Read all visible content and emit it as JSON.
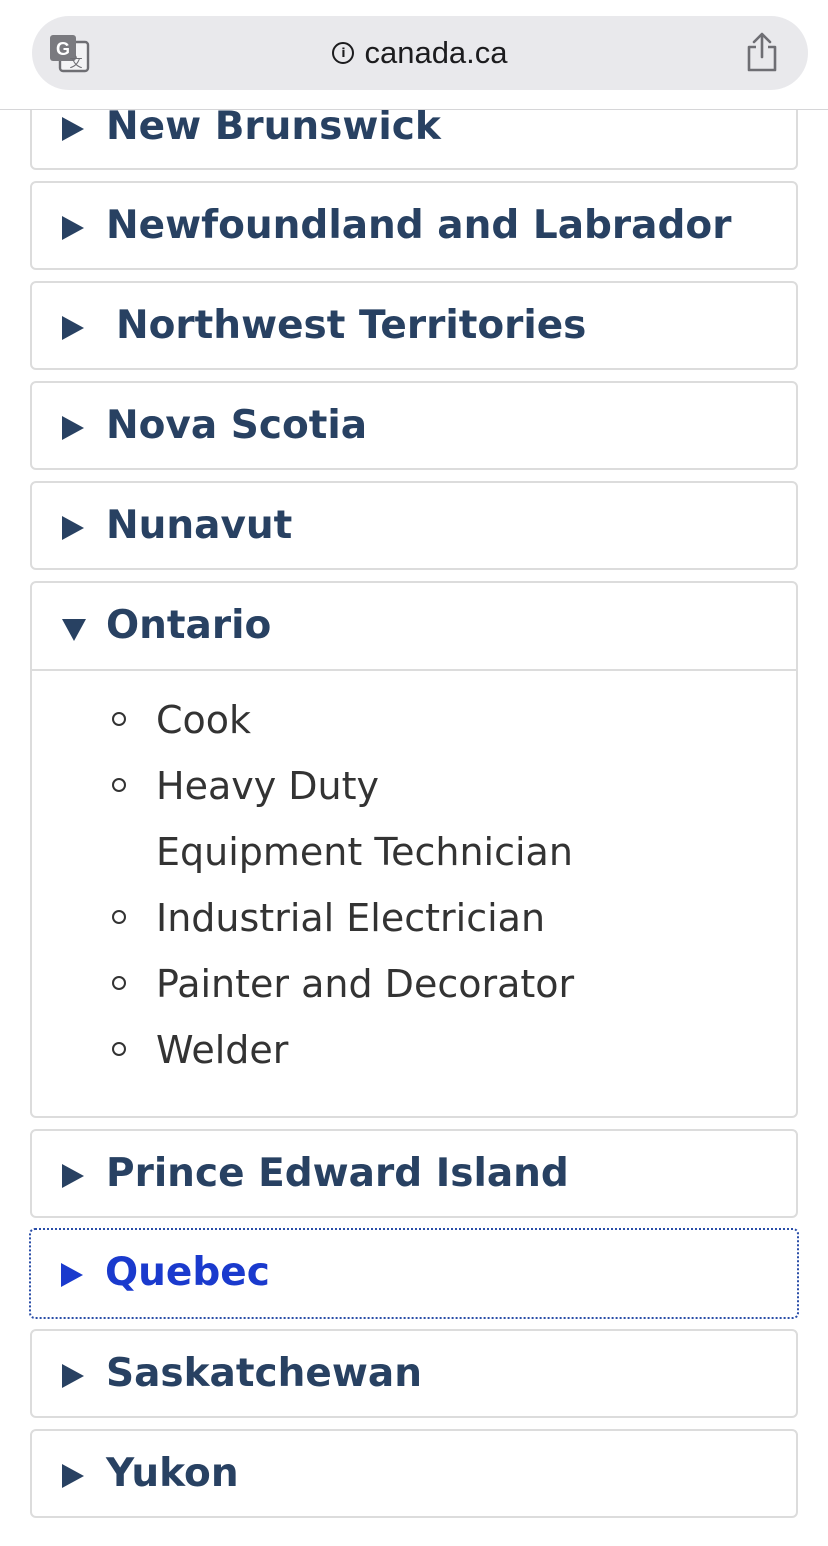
{
  "browser": {
    "url": "canada.ca"
  },
  "provinces": [
    {
      "name": "New Brunswick",
      "expanded": false
    },
    {
      "name": "Newfoundland and Labrador",
      "expanded": false
    },
    {
      "name": "Northwest Territories",
      "expanded": false
    },
    {
      "name": "Nova Scotia",
      "expanded": false
    },
    {
      "name": "Nunavut",
      "expanded": false
    },
    {
      "name": "Ontario",
      "expanded": true,
      "items": [
        "Cook",
        "Heavy Duty Equipment Technician",
        "Industrial Electrician",
        "Painter and Decorator",
        "Welder"
      ]
    },
    {
      "name": "Prince Edward Island",
      "expanded": false
    },
    {
      "name": "Quebec",
      "expanded": false,
      "focused": true
    },
    {
      "name": "Saskatchewan",
      "expanded": false
    },
    {
      "name": "Yukon",
      "expanded": false
    }
  ],
  "colors": {
    "heading": "#284162",
    "focused": "#1a3acd",
    "text": "#333333",
    "border": "#dcdcdc"
  }
}
